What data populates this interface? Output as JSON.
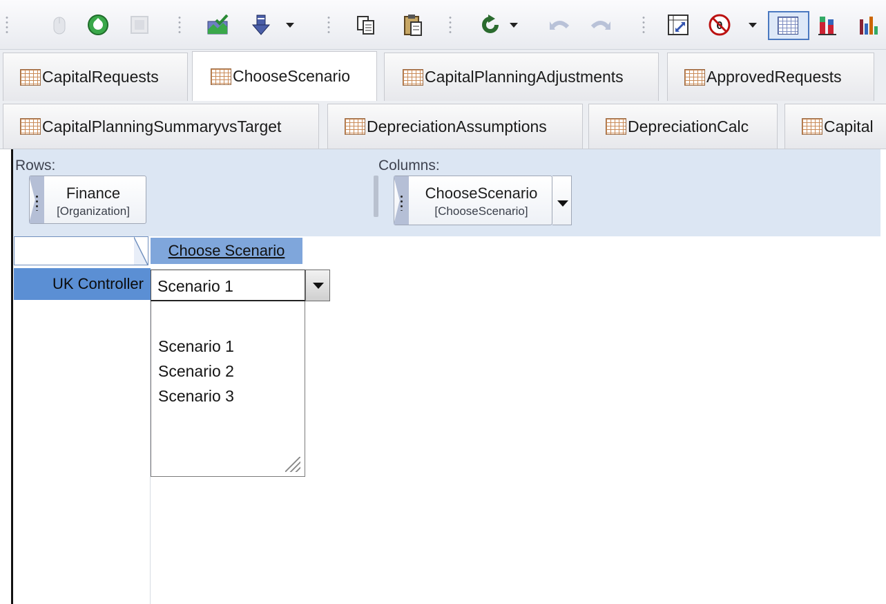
{
  "toolbar": {
    "buttons": [
      {
        "icon": "mouse-icon",
        "enabled": false
      },
      {
        "icon": "refresh-green-icon",
        "enabled": true
      },
      {
        "icon": "blank-page-icon",
        "enabled": false
      },
      {
        "icon": "chart-check-icon",
        "enabled": true
      },
      {
        "icon": "export-down-arrow-icon",
        "enabled": true,
        "dropdown": true
      },
      {
        "icon": "copy-icon",
        "enabled": true
      },
      {
        "icon": "paste-icon",
        "enabled": true
      },
      {
        "icon": "recalculate-icon",
        "enabled": true,
        "dropdown": true
      },
      {
        "icon": "undo-icon",
        "enabled": false
      },
      {
        "icon": "redo-icon",
        "enabled": false
      },
      {
        "icon": "swap-axes-icon",
        "enabled": true
      },
      {
        "icon": "suppress-zero-icon",
        "enabled": true,
        "dropdown": true
      },
      {
        "icon": "grid-view-icon",
        "enabled": true,
        "active": true
      },
      {
        "icon": "stacked-bar-chart-icon",
        "enabled": true
      },
      {
        "icon": "bar-chart-icon",
        "enabled": true
      }
    ]
  },
  "tabs": {
    "row1": [
      {
        "label": "CapitalRequests",
        "active": false
      },
      {
        "label": "ChooseScenario",
        "active": true
      },
      {
        "label": "CapitalPlanningAdjustments",
        "active": false
      },
      {
        "label": "ApprovedRequests",
        "active": false
      }
    ],
    "row2": [
      {
        "label": "CapitalPlanningSummaryvsTarget",
        "active": false
      },
      {
        "label": "DepreciationAssumptions",
        "active": false
      },
      {
        "label": "DepreciationCalc",
        "active": false
      },
      {
        "label": "Capital",
        "active": false
      }
    ]
  },
  "pivot": {
    "rows_label": "Rows:",
    "columns_label": "Columns:",
    "row_chip": {
      "name": "Finance",
      "dimension": "[Organization]"
    },
    "column_chip": {
      "name": "ChooseScenario",
      "dimension": "[ChooseScenario]"
    }
  },
  "grid": {
    "column_header": "Choose Scenario",
    "row_header": "UK Controller",
    "cell_value": "Scenario 1",
    "dropdown_options": [
      "",
      "Scenario 1",
      "Scenario 2",
      "Scenario 3"
    ]
  },
  "colors": {
    "pivot_background": "#dce6f3",
    "column_header": "#7fa6db",
    "row_header": "#5b8fd4",
    "active_toggle": "#4a78c0"
  }
}
